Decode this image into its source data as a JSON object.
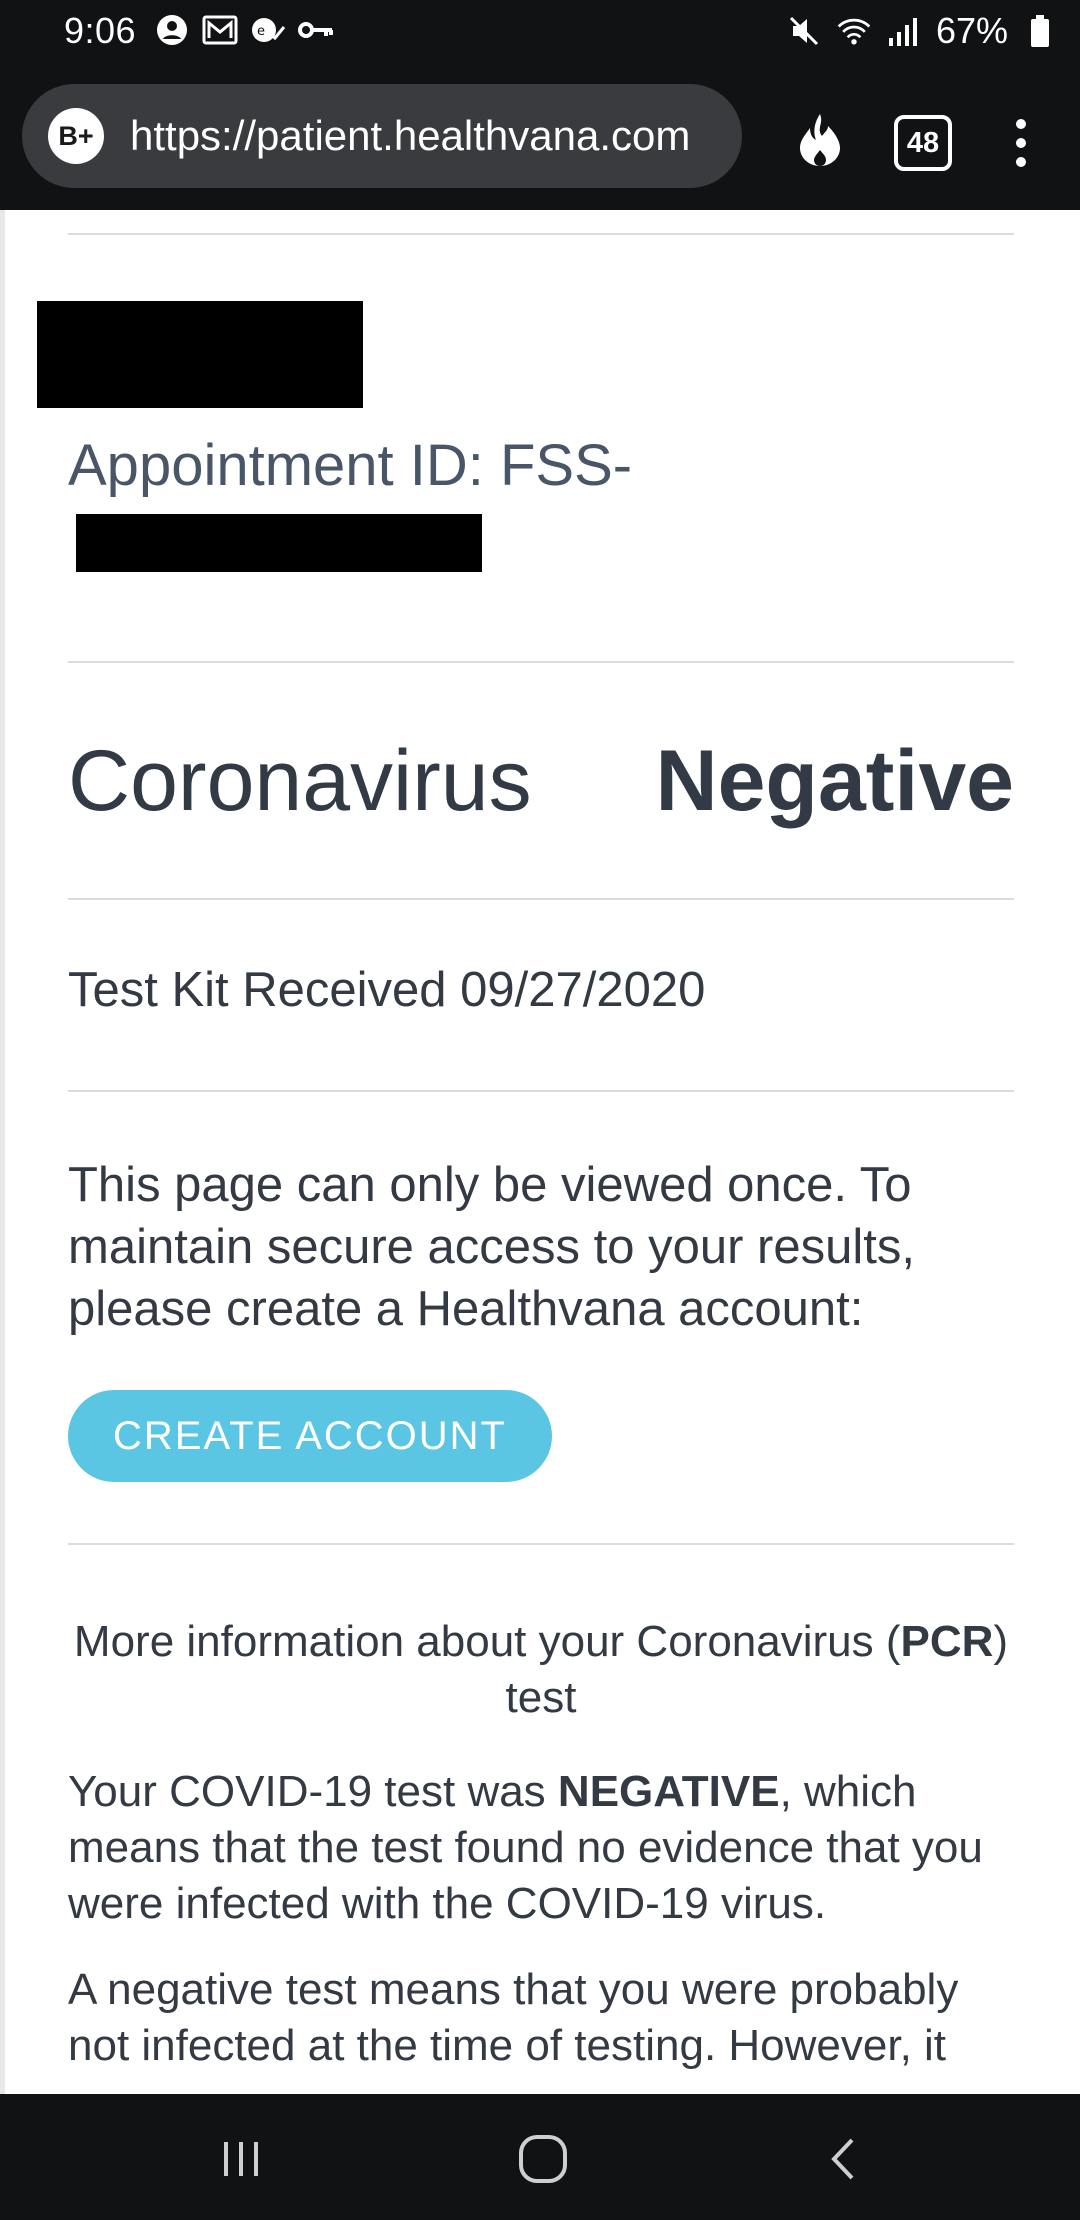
{
  "status_bar": {
    "time": "9:06",
    "battery": "67%",
    "left_icons": [
      "account-icon",
      "mail-icon",
      "vpn-check-icon",
      "key-icon"
    ],
    "right_icons": [
      "mute-icon",
      "wifi-icon",
      "signal-icon",
      "battery-icon"
    ]
  },
  "browser": {
    "badge": "B+",
    "url": "https://patient.healthvana.com",
    "tab_count": "48",
    "icons": [
      "fire-icon",
      "tabs-icon",
      "more-vert-icon"
    ]
  },
  "page": {
    "appointment_line1": "Appointment ID: FSS-",
    "result": {
      "test_name": "Coronavirus",
      "value": "Negative"
    },
    "kit_received": "Test Kit Received 09/27/2020",
    "notice": "This page can only be viewed once. To maintain secure access to your results, please create a Healthvana account:",
    "create_account_label": "CREATE ACCOUNT",
    "more_info": {
      "prefix": "More information about your Coronavirus (",
      "bold": "PCR",
      "suffix": ") test"
    },
    "paragraph1": {
      "prefix": "Your COVID-19 test was ",
      "bold": "NEGATIVE",
      "suffix": ", which means that the test found no evidence that you were infected with the COVID-19 virus."
    },
    "paragraph2": "A negative test means that you were probably not infected at the time of testing. However, it"
  },
  "nav_bar": {
    "icons": [
      "recent-apps-icon",
      "home-icon",
      "back-icon"
    ]
  },
  "colors": {
    "button": "#5bc6e3",
    "heading": "#323a45",
    "appointment": "#495667",
    "system_bar": "#111214"
  }
}
